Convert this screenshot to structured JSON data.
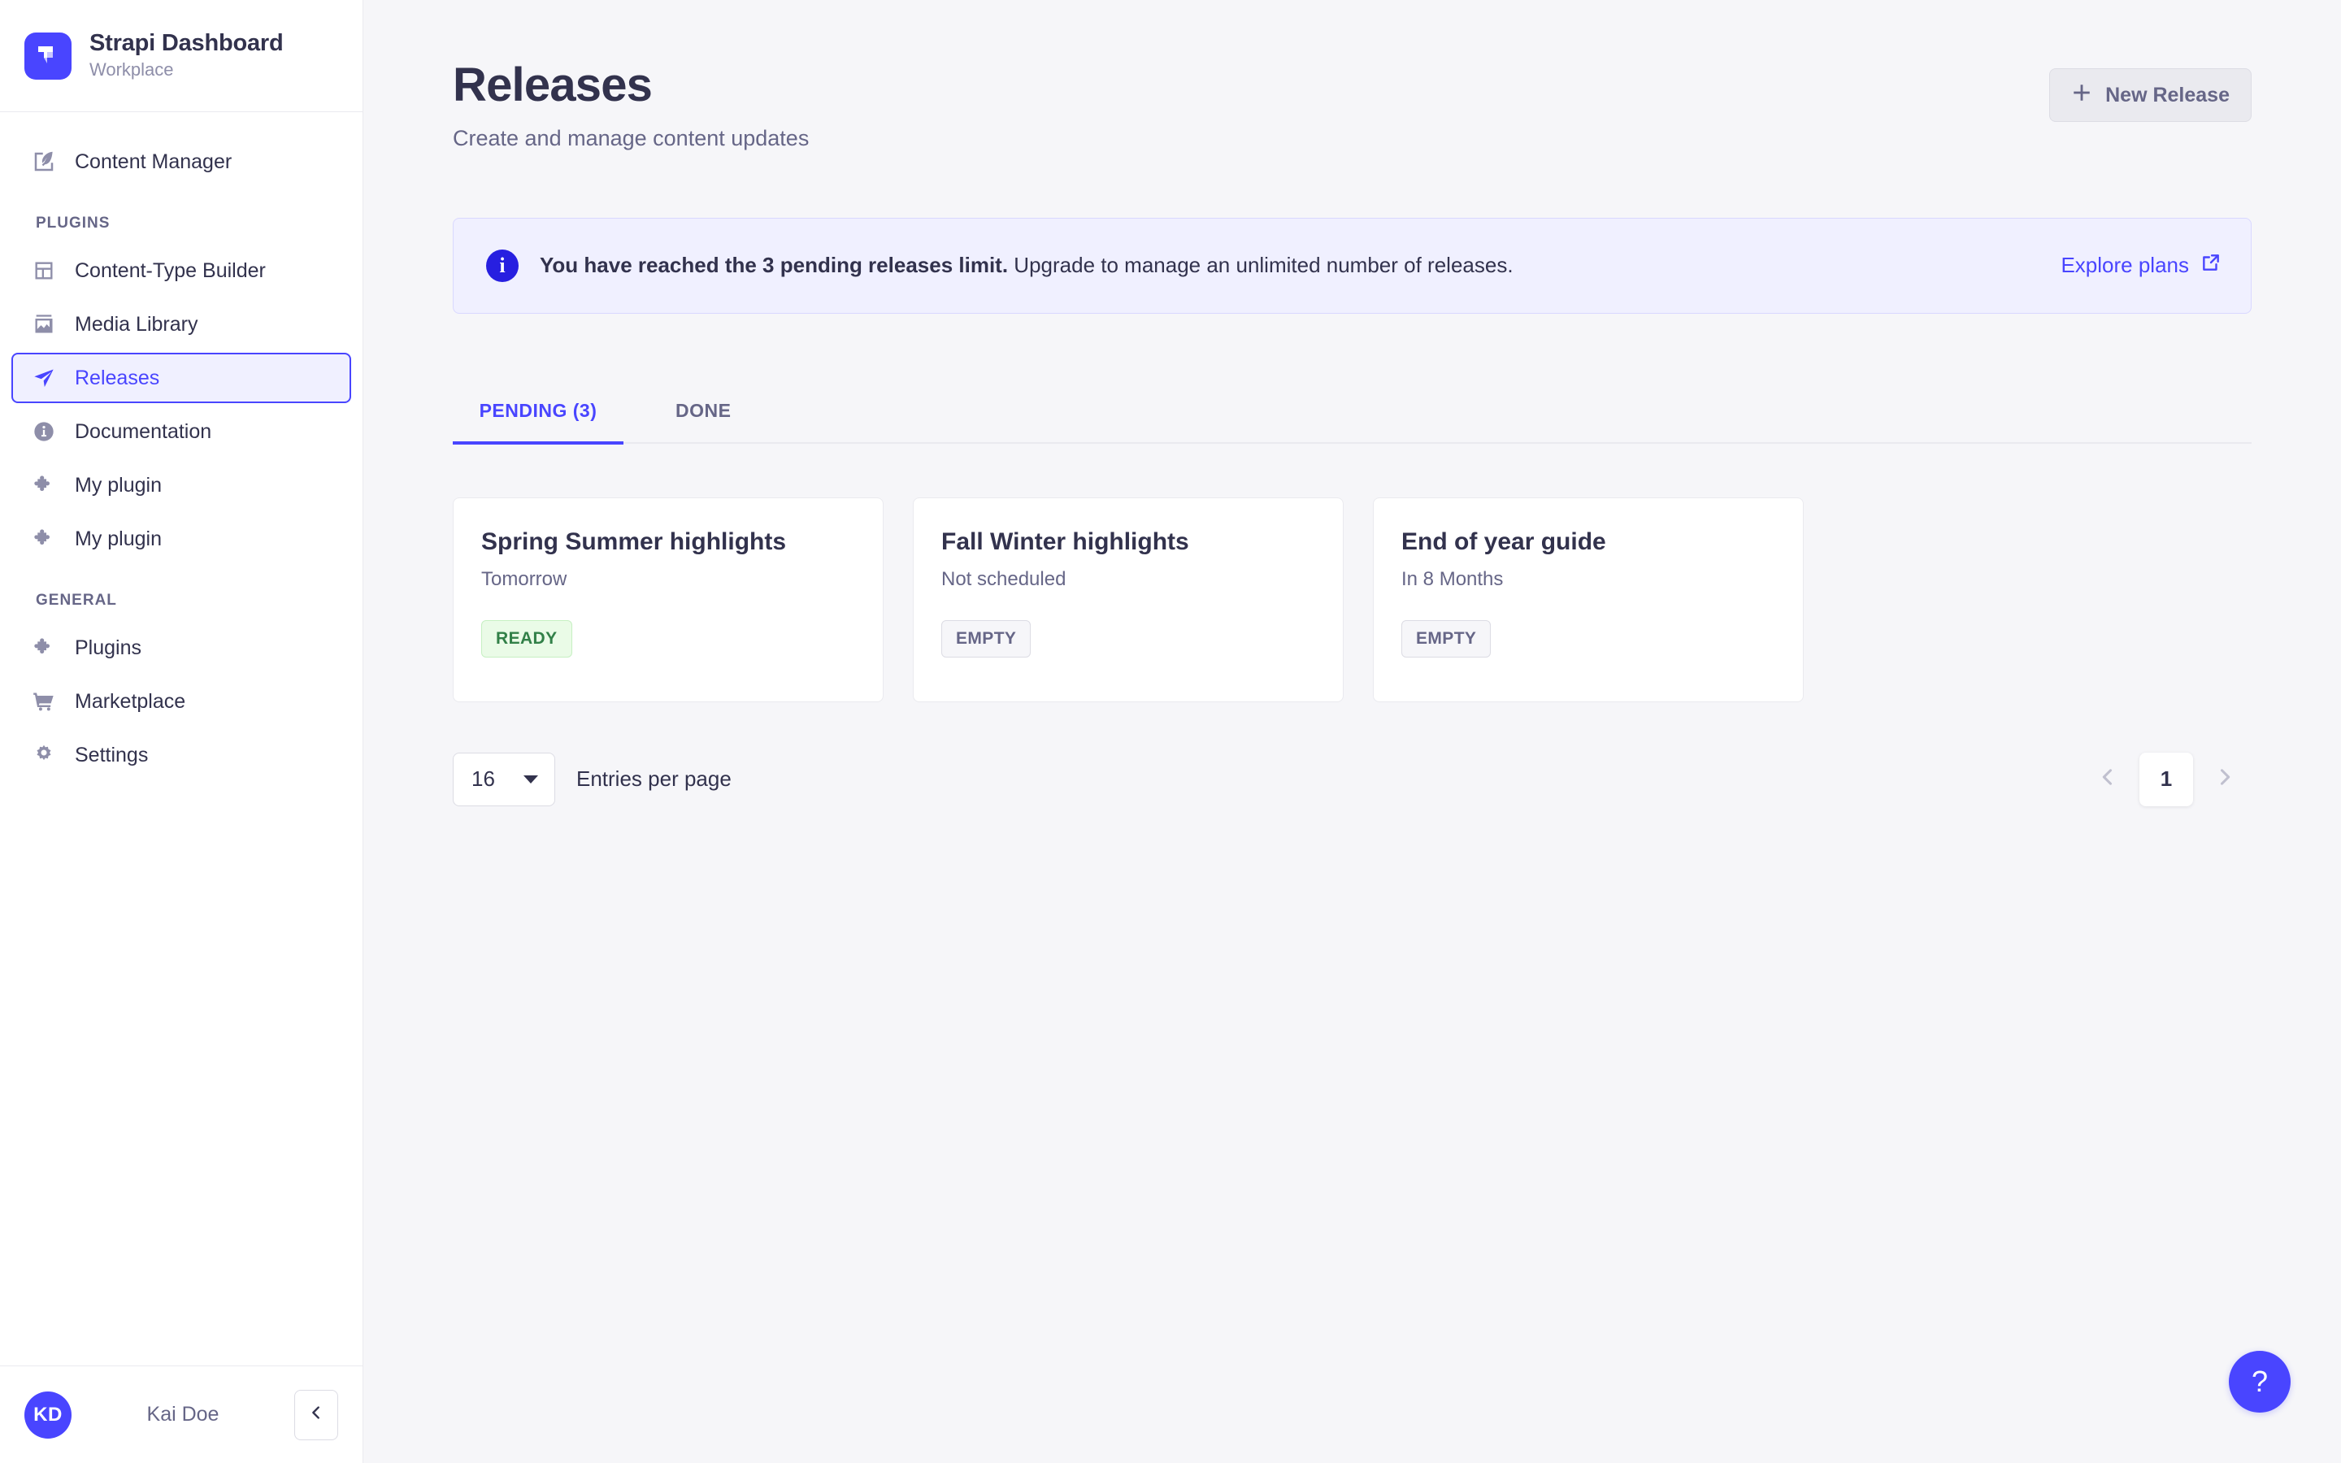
{
  "brand": {
    "title": "Strapi Dashboard",
    "subtitle": "Workplace",
    "logo_icon": "strapi-logo-icon",
    "logo_color": "#4945ff"
  },
  "sidebar": {
    "top_items": [
      {
        "label": "Content Manager",
        "icon": "feather-pen-icon",
        "active": false
      }
    ],
    "sections": [
      {
        "label": "PLUGINS",
        "items": [
          {
            "label": "Content-Type Builder",
            "icon": "layout-builder-icon",
            "active": false
          },
          {
            "label": "Media Library",
            "icon": "image-icon",
            "active": false
          },
          {
            "label": "Releases",
            "icon": "paper-plane-icon",
            "active": true
          },
          {
            "label": "Documentation",
            "icon": "info-circle-icon",
            "active": false
          },
          {
            "label": "My plugin",
            "icon": "puzzle-piece-icon",
            "active": false
          },
          {
            "label": "My plugin",
            "icon": "puzzle-piece-icon",
            "active": false
          }
        ]
      },
      {
        "label": "GENERAL",
        "items": [
          {
            "label": "Plugins",
            "icon": "puzzle-piece-icon",
            "active": false
          },
          {
            "label": "Marketplace",
            "icon": "shopping-cart-icon",
            "active": false
          },
          {
            "label": "Settings",
            "icon": "gear-icon",
            "active": false
          }
        ]
      }
    ],
    "footer": {
      "avatar_initials": "KD",
      "user_name": "Kai Doe",
      "collapse_icon": "chevron-left-icon"
    }
  },
  "header": {
    "title": "Releases",
    "subtitle": "Create and manage content updates",
    "new_release_label": "New Release",
    "new_release_icon": "plus-icon"
  },
  "banner": {
    "icon": "info-icon",
    "bold_text": "You have reached the 3 pending releases limit.",
    "rest_text": "Upgrade to manage an unlimited number of releases.",
    "link_label": "Explore plans",
    "link_icon": "external-link-icon",
    "accent_color": "#271fe0",
    "background": "#f0f0ff"
  },
  "tabs": [
    {
      "label": "PENDING (3)",
      "active": true
    },
    {
      "label": "DONE",
      "active": false
    }
  ],
  "releases": [
    {
      "title": "Spring Summer highlights",
      "date": "Tomorrow",
      "status": "READY",
      "status_type": "ready"
    },
    {
      "title": "Fall Winter highlights",
      "date": "Not scheduled",
      "status": "EMPTY",
      "status_type": "empty"
    },
    {
      "title": "End of year guide",
      "date": "In 8 Months",
      "status": "EMPTY",
      "status_type": "empty"
    }
  ],
  "pagination": {
    "entries_per_page_value": "16",
    "entries_per_page_label": "Entries per page",
    "current_page": "1",
    "prev_icon": "chevron-left-icon",
    "next_icon": "chevron-right-icon"
  },
  "help": {
    "label": "?"
  }
}
